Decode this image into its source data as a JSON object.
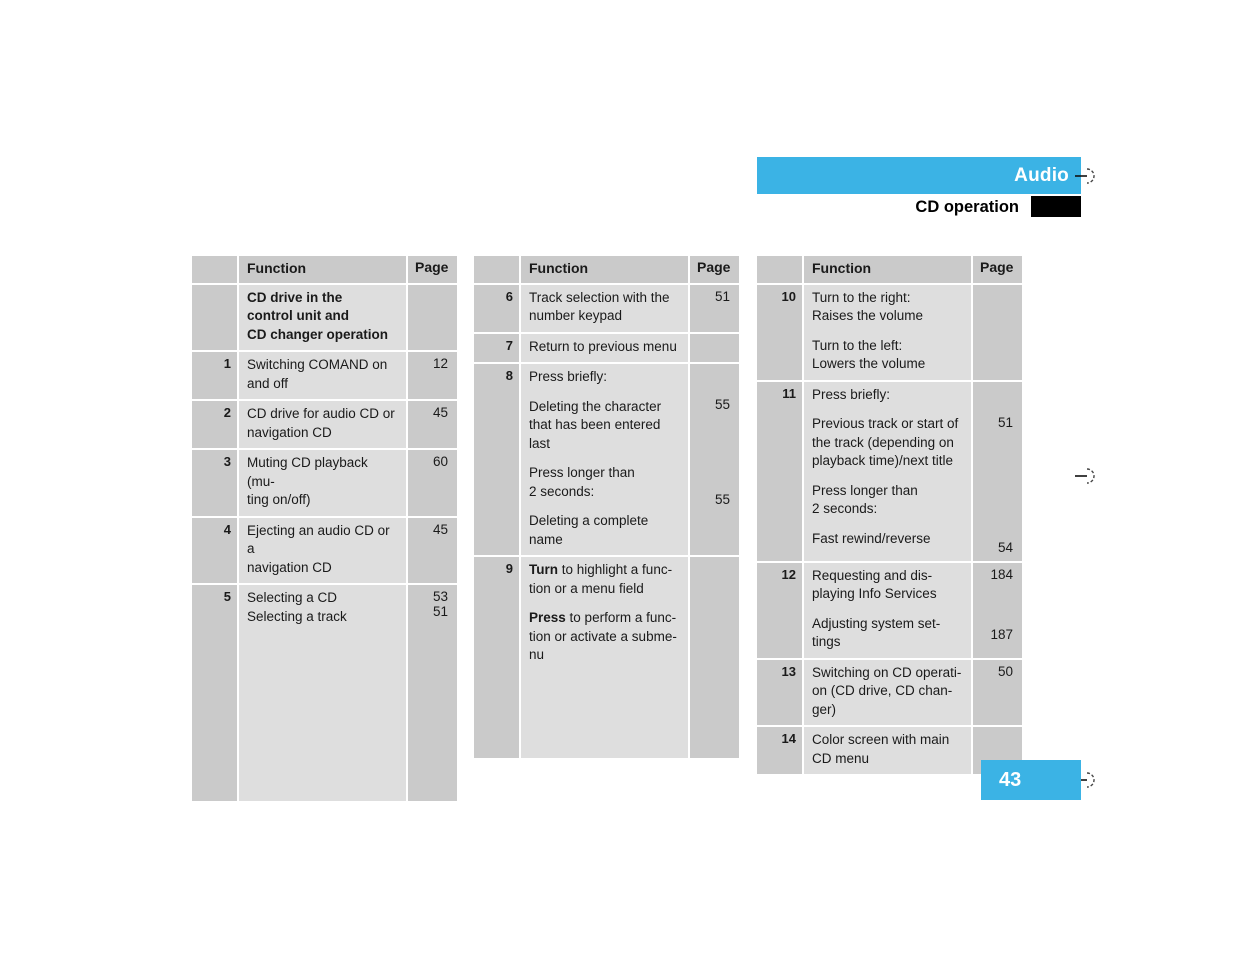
{
  "header": {
    "title": "Audio",
    "subtitle": "CD operation",
    "bar_color": "#3bb3e5",
    "tab_color": "#000000"
  },
  "footer": {
    "page_number": "43",
    "badge_color": "#3bb3e5"
  },
  "column_headers": {
    "number": "",
    "function": "Function",
    "page": "Page"
  },
  "tables": [
    {
      "id": "table-1",
      "rows": [
        {
          "num": "",
          "lines": [
            {
              "text": "CD drive in the",
              "bold": true,
              "gap": false
            },
            {
              "text": "control unit and",
              "bold": true,
              "gap": false
            },
            {
              "text": "CD changer operation",
              "bold": true,
              "gap": false
            }
          ],
          "pages": []
        },
        {
          "num": "1",
          "lines": [
            {
              "text": "Switching COMAND on",
              "bold": false,
              "gap": false
            },
            {
              "text": "and off",
              "bold": false,
              "gap": false
            }
          ],
          "pages": [
            {
              "text": "12",
              "gap": false
            }
          ]
        },
        {
          "num": "2",
          "lines": [
            {
              "text": "CD drive for audio CD or",
              "bold": false,
              "gap": false
            },
            {
              "text": "navigation CD",
              "bold": false,
              "gap": false
            }
          ],
          "pages": [
            {
              "text": "45",
              "gap": false
            }
          ]
        },
        {
          "num": "3",
          "lines": [
            {
              "text": "Muting CD playback (mu-",
              "bold": false,
              "gap": false
            },
            {
              "text": "ting on/off)",
              "bold": false,
              "gap": false
            }
          ],
          "pages": [
            {
              "text": "60",
              "gap": false
            }
          ]
        },
        {
          "num": "4",
          "lines": [
            {
              "text": "Ejecting an audio CD or a",
              "bold": false,
              "gap": false
            },
            {
              "text": "navigation CD",
              "bold": false,
              "gap": false
            }
          ],
          "pages": [
            {
              "text": "45",
              "gap": false
            }
          ]
        },
        {
          "num": "5",
          "lines": [
            {
              "text": "Selecting a CD",
              "bold": false,
              "gap": false
            },
            {
              "text": "Selecting a track",
              "bold": false,
              "gap": false
            }
          ],
          "pages": [
            {
              "text": "53",
              "gap": false
            },
            {
              "text": "51",
              "gap": false
            }
          ],
          "filler_height": 175
        }
      ]
    },
    {
      "id": "table-2",
      "rows": [
        {
          "num": "6",
          "lines": [
            {
              "text": "Track selection with the",
              "bold": false,
              "gap": false
            },
            {
              "text": "number keypad",
              "bold": false,
              "gap": false
            }
          ],
          "pages": [
            {
              "text": "51",
              "gap": false
            }
          ]
        },
        {
          "num": "7",
          "lines": [
            {
              "text": "Return to previous menu",
              "bold": false,
              "gap": false
            }
          ],
          "pages": []
        },
        {
          "num": "8",
          "lines": [
            {
              "text": "Press briefly:",
              "bold": false,
              "gap": false
            },
            {
              "text": "Deleting the character",
              "bold": false,
              "gap": true
            },
            {
              "text": "that has been entered",
              "bold": false,
              "gap": false
            },
            {
              "text": "last",
              "bold": false,
              "gap": false
            },
            {
              "text": "Press longer than",
              "bold": false,
              "gap": true
            },
            {
              "text": "2 seconds:",
              "bold": false,
              "gap": false
            },
            {
              "text": "Deleting a complete",
              "bold": false,
              "gap": true
            },
            {
              "text": "name",
              "bold": false,
              "gap": false
            }
          ],
          "pages": [
            {
              "text": "55",
              "gap": true,
              "offset": 29
            },
            {
              "text": "55",
              "gap": true,
              "offset": 80
            }
          ]
        },
        {
          "num": "9",
          "lines": [
            {
              "text": "Turn to highlight a func-",
              "bold": false,
              "gap": false,
              "bold_prefix": "Turn"
            },
            {
              "text": "tion or a menu field",
              "bold": false,
              "gap": false
            },
            {
              "text": "Press to perform a func-",
              "bold": false,
              "gap": true,
              "bold_prefix": "Press"
            },
            {
              "text": "tion or activate a subme-",
              "bold": false,
              "gap": false
            },
            {
              "text": "nu",
              "bold": false,
              "gap": false
            }
          ],
          "pages": [],
          "filler_height": 93
        }
      ]
    },
    {
      "id": "table-3",
      "rows": [
        {
          "num": "10",
          "lines": [
            {
              "text": "Turn to the right:",
              "bold": false,
              "gap": false
            },
            {
              "text": "Raises the volume",
              "bold": false,
              "gap": false
            },
            {
              "text": "Turn to the left:",
              "bold": false,
              "gap": true
            },
            {
              "text": "Lowers the volume",
              "bold": false,
              "gap": false
            }
          ],
          "pages": []
        },
        {
          "num": "11",
          "lines": [
            {
              "text": "Press briefly:",
              "bold": false,
              "gap": false
            },
            {
              "text": "Previous track or start of",
              "bold": false,
              "gap": true
            },
            {
              "text": "the track (depending on",
              "bold": false,
              "gap": false
            },
            {
              "text": "playback time)/next title",
              "bold": false,
              "gap": false
            },
            {
              "text": "Press longer than",
              "bold": false,
              "gap": true
            },
            {
              "text": "2 seconds:",
              "bold": false,
              "gap": false
            },
            {
              "text": "Fast rewind/reverse",
              "bold": false,
              "gap": true
            }
          ],
          "pages": [
            {
              "text": "51",
              "gap": true,
              "offset": 29
            },
            {
              "text": "54",
              "gap": true,
              "offset": 110
            }
          ]
        },
        {
          "num": "12",
          "lines": [
            {
              "text": "Requesting and dis-",
              "bold": false,
              "gap": false
            },
            {
              "text": "playing Info Services",
              "bold": false,
              "gap": false
            },
            {
              "text": "Adjusting system set-",
              "bold": false,
              "gap": true
            },
            {
              "text": "tings",
              "bold": false,
              "gap": false
            }
          ],
          "pages": [
            {
              "text": "184",
              "gap": false,
              "offset": 0
            },
            {
              "text": "187",
              "gap": true,
              "offset": 45
            }
          ]
        },
        {
          "num": "13",
          "lines": [
            {
              "text": "Switching on CD operati-",
              "bold": false,
              "gap": false
            },
            {
              "text": "on (CD drive, CD chan-",
              "bold": false,
              "gap": false
            },
            {
              "text": "ger)",
              "bold": false,
              "gap": false
            }
          ],
          "pages": [
            {
              "text": "50",
              "gap": false
            }
          ]
        },
        {
          "num": "14",
          "lines": [
            {
              "text": "Color screen with main",
              "bold": false,
              "gap": false
            },
            {
              "text": "CD menu",
              "bold": false,
              "gap": false
            }
          ],
          "pages": []
        }
      ]
    }
  ]
}
